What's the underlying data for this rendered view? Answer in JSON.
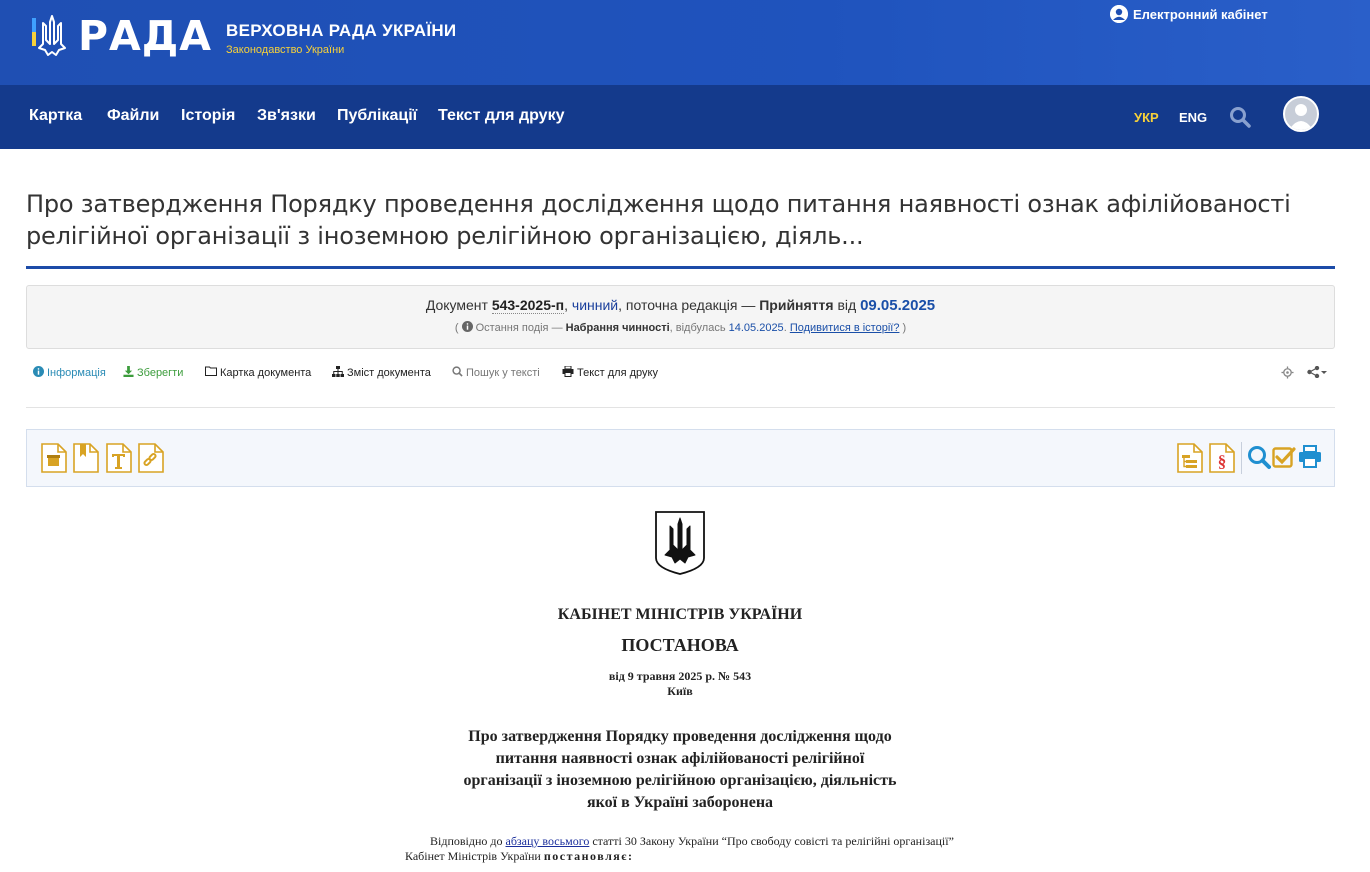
{
  "header": {
    "logo_word": "РАДА",
    "logo_title": "ВЕРХОВНА РАДА УКРАЇНИ",
    "logo_subtitle": "Законодавство України",
    "ecabinet_label": "Електронний кабінет"
  },
  "nav": {
    "items": [
      "Картка",
      "Файли",
      "Історія",
      "Зв'язки",
      "Публікації",
      "Текст для друку"
    ],
    "lang_active": "УКР",
    "lang_other": "ENG"
  },
  "page": {
    "title": "Про затвердження Порядку проведення дослідження щодо питання наявності ознак афілійованості релігійної організації з іноземною релігійною організацією, діяль..."
  },
  "status": {
    "prefix": "Документ",
    "number": "543-2025-п",
    "state": "чинний",
    "edition": ", поточна редакція — ",
    "event": "Прийняття",
    "from": " від ",
    "date": "09.05.2025",
    "last_prefix": "Остання подія — ",
    "last_event": "Набрання чинності",
    "last_mid": ", відбулась ",
    "last_date": "14.05.2025",
    "history_link": "Подивитися в історії?"
  },
  "toolbar": {
    "info": "Інформація",
    "save": "Зберегти",
    "card": "Картка документа",
    "contents": "Зміст документа",
    "search": "Пошук у тексті",
    "print": "Текст для друку"
  },
  "document": {
    "org": "КАБІНЕТ МІНІСТРІВ УКРАЇНИ",
    "kind": "ПОСТАНОВА",
    "date_line": "від 9 травня 2025 р. № 543",
    "city": "Київ",
    "heading_lines": [
      "Про затвердження Порядку проведення дослідження щодо",
      "питання наявності ознак афілійованості релігійної",
      "організації з іноземною релігійною організацією, діяльність",
      "якої в Україні заборонена"
    ],
    "para_before": "Відповідно до ",
    "para_link": "абзацу восьмого",
    "para_after": " статті 30 Закону України “Про свободу совісті та релігійні організації” Кабінет Міністрів України ",
    "para_emph": "постановляє:"
  },
  "colors": {
    "header_blue": "#1f4fb3",
    "nav_blue": "#143a8c",
    "accent_yellow": "#f7d13a",
    "icon_gold": "#d8a324"
  }
}
